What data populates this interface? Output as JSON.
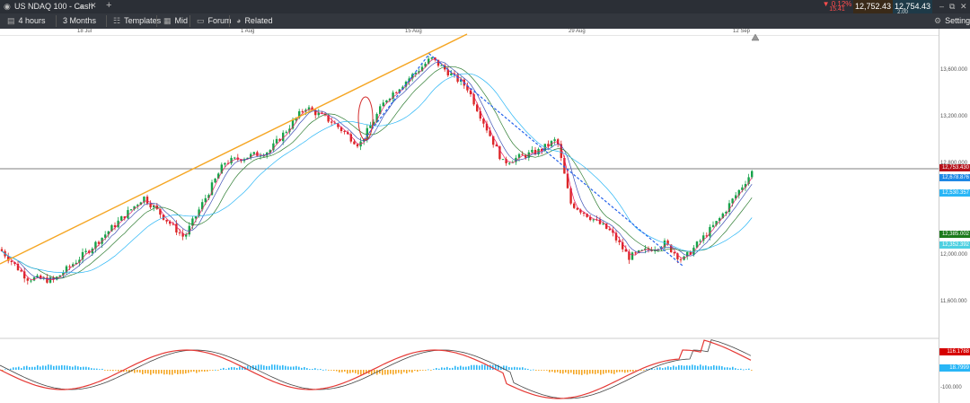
{
  "window": {
    "title": "US NDAQ 100 - Cash",
    "change_pct": "▼ 0.12%",
    "change_abs": "15.41",
    "sell_price": "12,752.43",
    "buy_price": "12,754.43",
    "spread": "2.00"
  },
  "toolbar": {
    "timeframe": "4 hours",
    "range": "3 Months",
    "templates": "Templates",
    "price_type": "Mid",
    "forum": "Forum",
    "related": "Related",
    "settings": "Settings"
  },
  "time_axis": [
    "18 Jul",
    "1 Aug",
    "15 Aug",
    "29 Aug",
    "12 Sep"
  ],
  "price_axis": [
    "13,600.000",
    "13,200.000",
    "12,800.000",
    "12,000.000",
    "11,600.000"
  ],
  "price_tags": [
    {
      "label": "12,753.430",
      "bg": "#b5121b",
      "fg": "#ffffff"
    },
    {
      "label": "12,678.876",
      "bg": "#1e88e5",
      "fg": "#ffffff"
    },
    {
      "label": "12,530.357",
      "bg": "#29b6f6",
      "fg": "#ffffff"
    },
    {
      "label": "12,385.002",
      "bg": "#1b7a1b",
      "fg": "#ffffff"
    },
    {
      "label": "12,352.392",
      "bg": "#4dd0e1",
      "fg": "#ffffff"
    }
  ],
  "indicator_tags": [
    {
      "label": "116.1788",
      "bg": "#d50000",
      "fg": "#ffffff"
    },
    {
      "label": "18.7999",
      "bg": "#29b6f6",
      "fg": "#ffffff"
    }
  ],
  "indicator_axis": [
    "-100.000"
  ],
  "colors": {
    "up": "#16a34a",
    "down": "#dc2626",
    "trendline": "#f5a623",
    "channel": "#2563eb"
  }
}
